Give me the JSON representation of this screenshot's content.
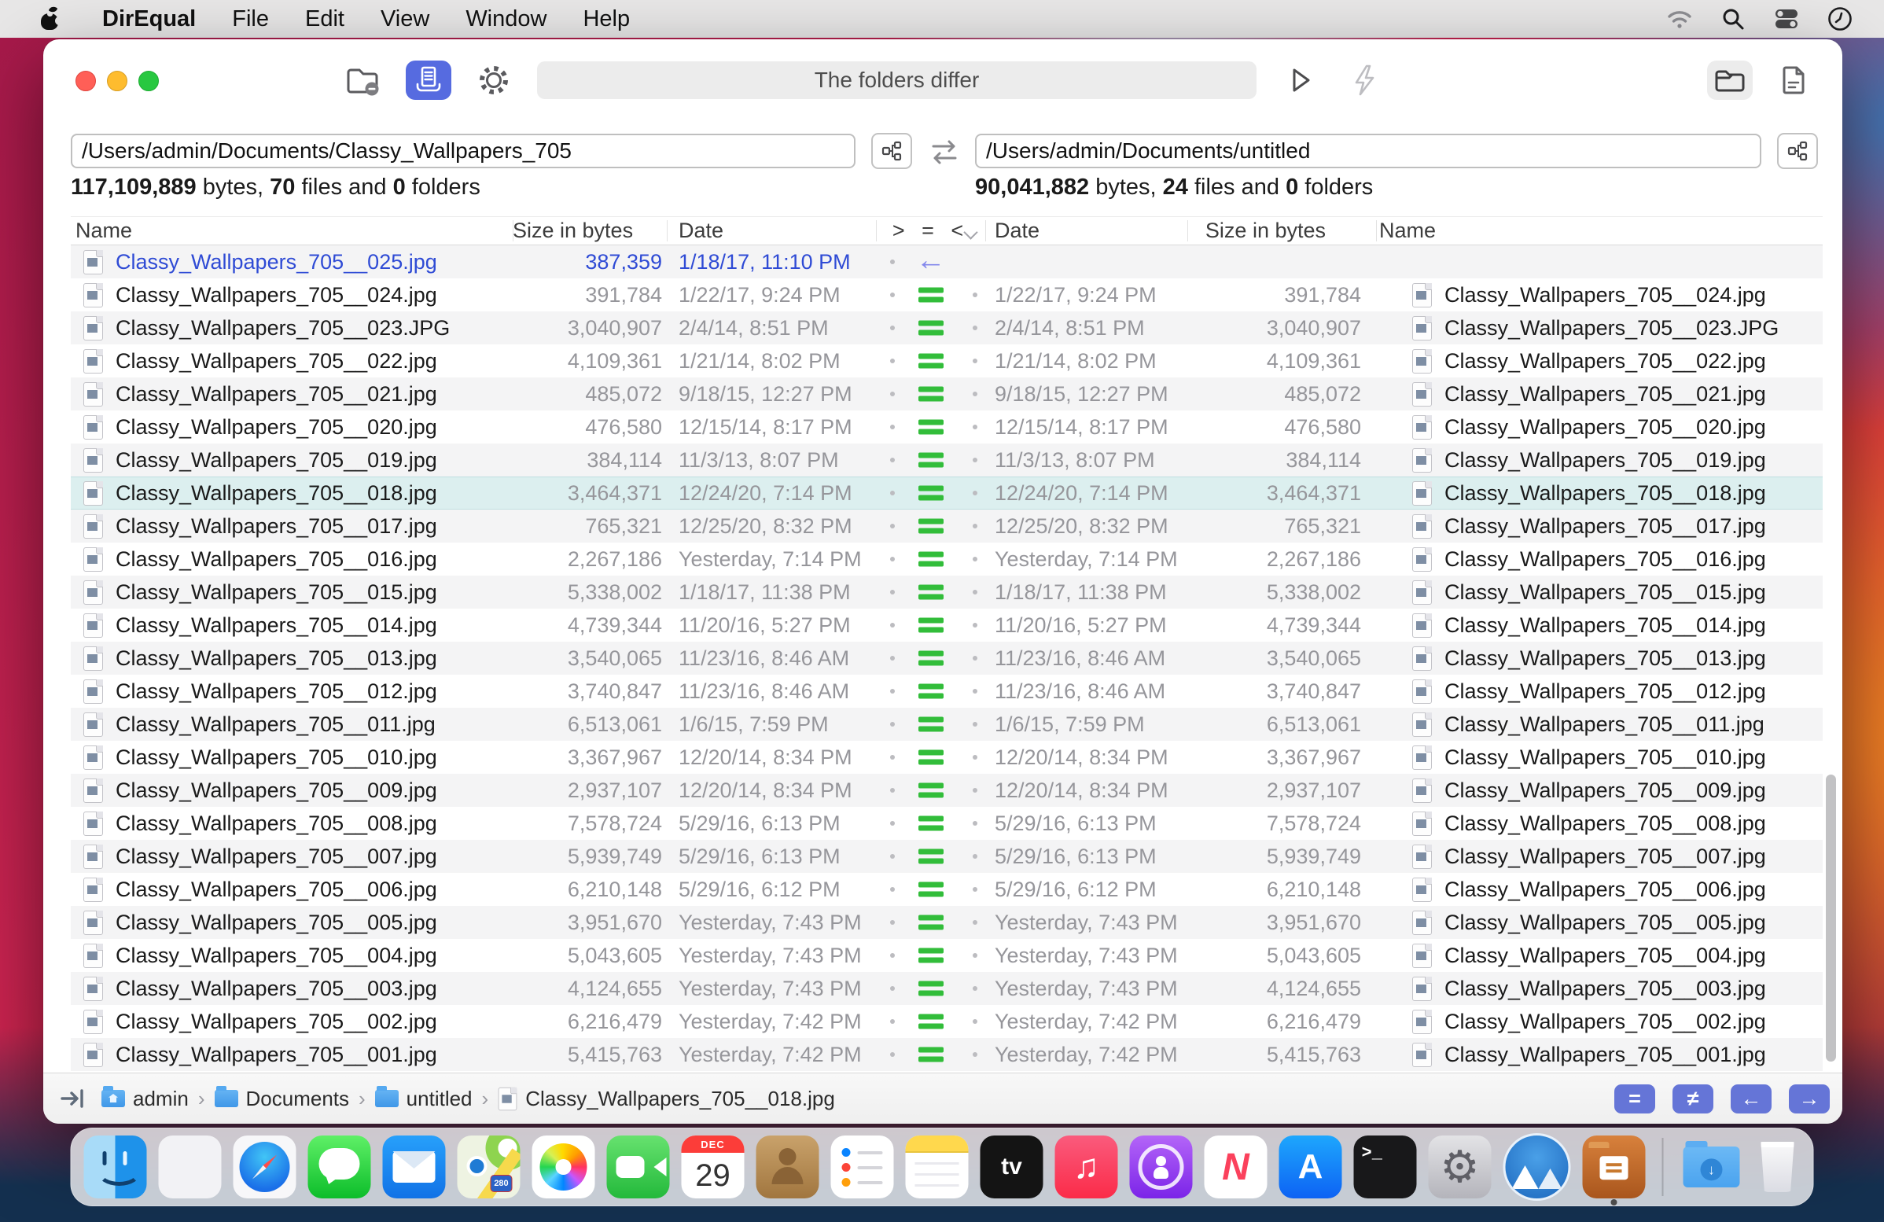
{
  "menu_bar": {
    "app_name": "DirEqual",
    "items": [
      "File",
      "Edit",
      "View",
      "Window",
      "Help"
    ]
  },
  "toolbar": {
    "status_text": "The folders differ"
  },
  "panes": {
    "left": {
      "path": "/Users/admin/Documents/Classy_Wallpapers_705",
      "bytes": "117,109,889",
      "bytes_label": " bytes, ",
      "files": "70",
      "files_label": " files and ",
      "folders": "0",
      "folders_label": " folders"
    },
    "right": {
      "path": "/Users/admin/Documents/untitled",
      "bytes": "90,041,882",
      "bytes_label": " bytes, ",
      "files": "24",
      "files_label": " files and ",
      "folders": "0",
      "folders_label": " folders"
    }
  },
  "table": {
    "headers_left": {
      "name": "Name",
      "size": "Size in bytes",
      "date": "Date"
    },
    "diff_header": "> = <",
    "headers_right": {
      "date": "Date",
      "size": "Size in bytes",
      "name": "Name"
    },
    "arrow_left": "←"
  },
  "rows": [
    {
      "name": "Classy_Wallpapers_705__025.jpg",
      "size": "387,359",
      "date": "1/18/17, 11:10 PM",
      "status": "left-only"
    },
    {
      "name": "Classy_Wallpapers_705__024.jpg",
      "size": "391,784",
      "date": "1/22/17, 9:24 PM",
      "status": "equal"
    },
    {
      "name": "Classy_Wallpapers_705__023.JPG",
      "size": "3,040,907",
      "date": "2/4/14, 8:51 PM",
      "status": "equal"
    },
    {
      "name": "Classy_Wallpapers_705__022.jpg",
      "size": "4,109,361",
      "date": "1/21/14, 8:02 PM",
      "status": "equal"
    },
    {
      "name": "Classy_Wallpapers_705__021.jpg",
      "size": "485,072",
      "date": "9/18/15, 12:27 PM",
      "status": "equal"
    },
    {
      "name": "Classy_Wallpapers_705__020.jpg",
      "size": "476,580",
      "date": "12/15/14, 8:17 PM",
      "status": "equal"
    },
    {
      "name": "Classy_Wallpapers_705__019.jpg",
      "size": "384,114",
      "date": "11/3/13, 8:07 PM",
      "status": "equal"
    },
    {
      "name": "Classy_Wallpapers_705__018.jpg",
      "size": "3,464,371",
      "date": "12/24/20, 7:14 PM",
      "status": "equal",
      "selected": true
    },
    {
      "name": "Classy_Wallpapers_705__017.jpg",
      "size": "765,321",
      "date": "12/25/20, 8:32 PM",
      "status": "equal"
    },
    {
      "name": "Classy_Wallpapers_705__016.jpg",
      "size": "2,267,186",
      "date": "Yesterday, 7:14 PM",
      "status": "equal"
    },
    {
      "name": "Classy_Wallpapers_705__015.jpg",
      "size": "5,338,002",
      "date": "1/18/17, 11:38 PM",
      "status": "equal"
    },
    {
      "name": "Classy_Wallpapers_705__014.jpg",
      "size": "4,739,344",
      "date": "11/20/16, 5:27 PM",
      "status": "equal"
    },
    {
      "name": "Classy_Wallpapers_705__013.jpg",
      "size": "3,540,065",
      "date": "11/23/16, 8:46 AM",
      "status": "equal"
    },
    {
      "name": "Classy_Wallpapers_705__012.jpg",
      "size": "3,740,847",
      "date": "11/23/16, 8:46 AM",
      "status": "equal"
    },
    {
      "name": "Classy_Wallpapers_705__011.jpg",
      "size": "6,513,061",
      "date": "1/6/15, 7:59 PM",
      "status": "equal"
    },
    {
      "name": "Classy_Wallpapers_705__010.jpg",
      "size": "3,367,967",
      "date": "12/20/14, 8:34 PM",
      "status": "equal"
    },
    {
      "name": "Classy_Wallpapers_705__009.jpg",
      "size": "2,937,107",
      "date": "12/20/14, 8:34 PM",
      "status": "equal"
    },
    {
      "name": "Classy_Wallpapers_705__008.jpg",
      "size": "7,578,724",
      "date": "5/29/16, 6:13 PM",
      "status": "equal"
    },
    {
      "name": "Classy_Wallpapers_705__007.jpg",
      "size": "5,939,749",
      "date": "5/29/16, 6:13 PM",
      "status": "equal"
    },
    {
      "name": "Classy_Wallpapers_705__006.jpg",
      "size": "6,210,148",
      "date": "5/29/16, 6:12 PM",
      "status": "equal"
    },
    {
      "name": "Classy_Wallpapers_705__005.jpg",
      "size": "3,951,670",
      "date": "Yesterday, 7:43 PM",
      "status": "equal"
    },
    {
      "name": "Classy_Wallpapers_705__004.jpg",
      "size": "5,043,605",
      "date": "Yesterday, 7:43 PM",
      "status": "equal"
    },
    {
      "name": "Classy_Wallpapers_705__003.jpg",
      "size": "4,124,655",
      "date": "Yesterday, 7:43 PM",
      "status": "equal"
    },
    {
      "name": "Classy_Wallpapers_705__002.jpg",
      "size": "6,216,479",
      "date": "Yesterday, 7:42 PM",
      "status": "equal"
    },
    {
      "name": "Classy_Wallpapers_705__001.jpg",
      "size": "5,415,763",
      "date": "Yesterday, 7:42 PM",
      "status": "equal"
    }
  ],
  "status_bar": {
    "separator": "›",
    "breadcrumb": [
      {
        "label": "admin",
        "icon": "home-folder"
      },
      {
        "label": "Documents",
        "icon": "folder"
      },
      {
        "label": "untitled",
        "icon": "folder"
      },
      {
        "label": "Classy_Wallpapers_705__018.jpg",
        "icon": "file"
      }
    ],
    "buttons": [
      "=",
      "≠",
      "←",
      "→"
    ]
  },
  "dock": {
    "calendar_month": "DEC",
    "calendar_day": "29",
    "glyphs": {
      "tv": "tv",
      "music": "♫",
      "news": "N",
      "app_store": "A",
      "terminal": ">_",
      "maps_shield": "280",
      "downloads_arrow": "↓"
    }
  },
  "colors": {
    "accent_blue": "#566be0",
    "equal_green": "#32bd3a",
    "left_only_blue": "#2f4bd5",
    "selection_teal": "#dcefef",
    "button_blue": "#6575d7"
  }
}
